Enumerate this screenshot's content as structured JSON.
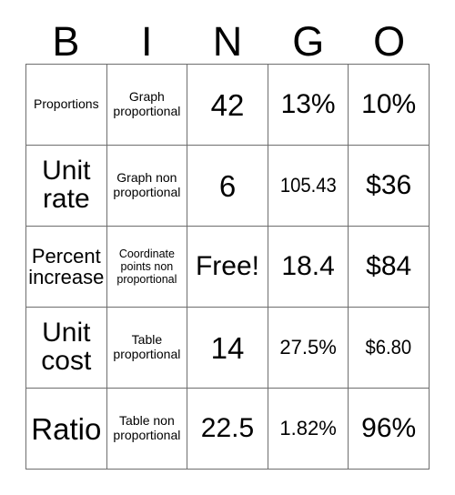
{
  "card": {
    "title": "BINGO",
    "header_letters": [
      "B",
      "I",
      "N",
      "G",
      "O"
    ],
    "free_space": "Free!",
    "grid_line_color": "#6e6e6e",
    "background_color": "#ffffff",
    "text_color": "#000000",
    "rows": 5,
    "columns": 5,
    "cells": [
      [
        {
          "text": "Proportions",
          "size": "t-sm",
          "column": "B",
          "row": 1
        },
        {
          "text": "Graph proportional",
          "size": "t-sm",
          "column": "I",
          "row": 1
        },
        {
          "text": "42",
          "size": "t-xl",
          "column": "N",
          "row": 1
        },
        {
          "text": "13%",
          "size": "t-lg",
          "column": "G",
          "row": 1
        },
        {
          "text": "10%",
          "size": "t-lg",
          "column": "O",
          "row": 1
        }
      ],
      [
        {
          "text": "Unit rate",
          "size": "t-lg",
          "column": "B",
          "row": 2
        },
        {
          "text": "Graph non proportional",
          "size": "t-sm",
          "column": "I",
          "row": 2
        },
        {
          "text": "6",
          "size": "t-xl",
          "column": "N",
          "row": 2
        },
        {
          "text": "105.43",
          "size": "t-md",
          "column": "G",
          "row": 2
        },
        {
          "text": "$36",
          "size": "t-lg",
          "column": "O",
          "row": 2
        }
      ],
      [
        {
          "text": "Percent increase",
          "size": "t-md",
          "column": "B",
          "row": 3
        },
        {
          "text": "Coordinate points non proportional",
          "size": "t-xs",
          "column": "I",
          "row": 3
        },
        {
          "text": "Free!",
          "size": "t-free",
          "column": "N",
          "row": 3
        },
        {
          "text": "18.4",
          "size": "t-lg",
          "column": "G",
          "row": 3
        },
        {
          "text": "$84",
          "size": "t-lg",
          "column": "O",
          "row": 3
        }
      ],
      [
        {
          "text": "Unit cost",
          "size": "t-lg",
          "column": "B",
          "row": 4
        },
        {
          "text": "Table proportional",
          "size": "t-sm",
          "column": "I",
          "row": 4
        },
        {
          "text": "14",
          "size": "t-xl",
          "column": "N",
          "row": 4
        },
        {
          "text": "27.5%",
          "size": "t-md",
          "column": "G",
          "row": 4
        },
        {
          "text": "$6.80",
          "size": "t-md",
          "column": "O",
          "row": 4
        }
      ],
      [
        {
          "text": "Ratio",
          "size": "t-xl",
          "column": "B",
          "row": 5
        },
        {
          "text": "Table non proportional",
          "size": "t-sm",
          "column": "I",
          "row": 5
        },
        {
          "text": "22.5",
          "size": "t-lg",
          "column": "N",
          "row": 5
        },
        {
          "text": "1.82%",
          "size": "t-md",
          "column": "G",
          "row": 5
        },
        {
          "text": "96%",
          "size": "t-lg",
          "column": "O",
          "row": 5
        }
      ]
    ]
  }
}
